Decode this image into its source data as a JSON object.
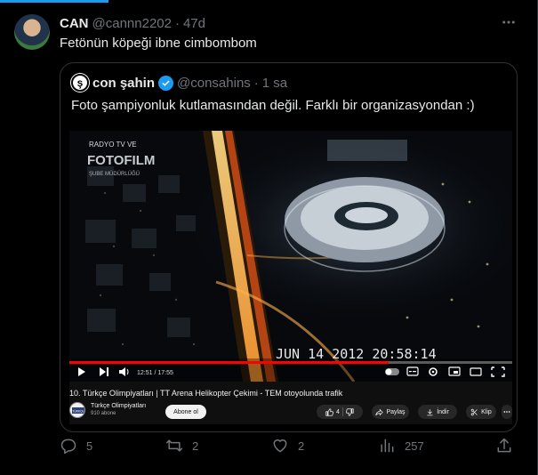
{
  "tweet": {
    "author_name": "CAN",
    "author_handle": "@cannn2202",
    "separator": "·",
    "time": "47d",
    "text": "Fetönün köpeği ibne cimbombom"
  },
  "quote": {
    "author_name": "con şahin",
    "author_handle": "@consahins",
    "separator": "·",
    "time": "1 sa",
    "text": "Foto şampiyonluk kutlamasından değil. Farklı bir organizasyondan :)"
  },
  "video": {
    "overlay_radyo": "RADYO TV VE",
    "overlay_logo": "FOTOFILM",
    "overlay_sube": "ŞUBE MÜDÜRLÜĞÜ",
    "timestamp_overlay": "JUN 14 2012 20:58:14",
    "time_display": "12:51 / 17:55",
    "progress_fraction": 0.72,
    "title": "10. Türkçe Olimpiyatları | TT Arena Helikopter Çekimi - TEM otoyolunda trafik",
    "channel_name": "Türkçe Olimpiyatları",
    "channel_avatar_text": "TÜRKÇE",
    "subscribers": "910 abone",
    "subscribe_label": "Abone ol",
    "like_count": "4",
    "share_label": "Paylaş",
    "download_label": "İndir",
    "clip_label": "Klip"
  },
  "actions": {
    "replies": "5",
    "reposts": "2",
    "likes": "2",
    "views": "257"
  },
  "colors": {
    "accent": "#1d9bf0",
    "text_primary": "#e7e9ea",
    "text_secondary": "#71767b",
    "border": "#2f3336",
    "progress_red": "#ff0000"
  }
}
